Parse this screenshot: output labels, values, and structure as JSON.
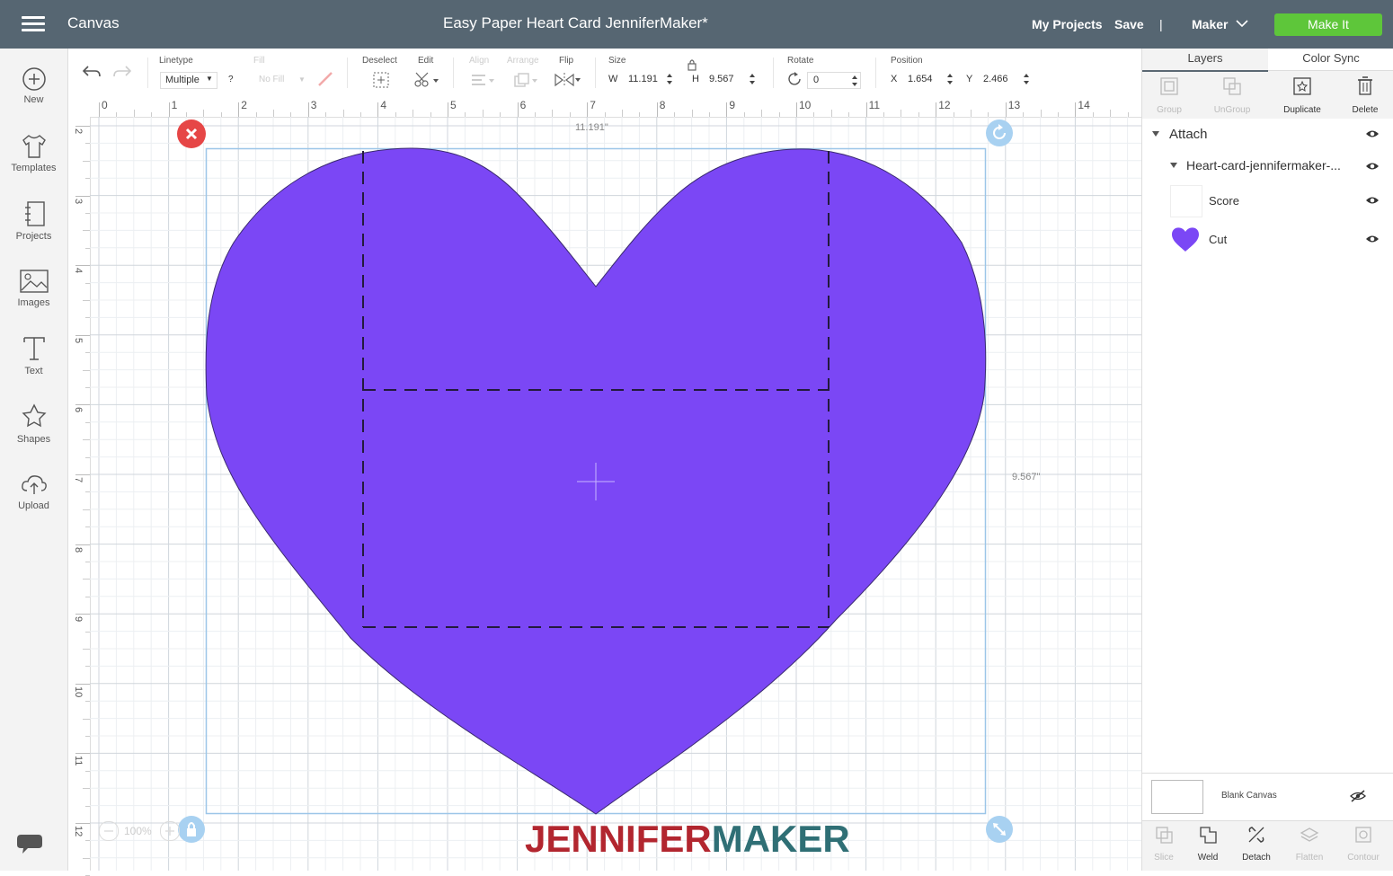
{
  "header": {
    "app_name": "Canvas",
    "project_title": "Easy Paper Heart Card JenniferMaker*",
    "my_projects": "My Projects",
    "save": "Save",
    "divider": "|",
    "machine": "Maker",
    "make_it": "Make It"
  },
  "sidebar": {
    "items": [
      {
        "label": "New",
        "icon": "plus-circle-icon"
      },
      {
        "label": "Templates",
        "icon": "shirt-icon"
      },
      {
        "label": "Projects",
        "icon": "projects-icon"
      },
      {
        "label": "Images",
        "icon": "image-icon"
      },
      {
        "label": "Text",
        "icon": "text-icon"
      },
      {
        "label": "Shapes",
        "icon": "shapes-icon"
      },
      {
        "label": "Upload",
        "icon": "upload-icon"
      }
    ]
  },
  "toolbar": {
    "linetype_label": "Linetype",
    "linetype_value": "Multiple",
    "linetype_help": "?",
    "fill_label": "Fill",
    "fill_value": "No Fill",
    "deselect_label": "Deselect",
    "edit_label": "Edit",
    "align_label": "Align",
    "arrange_label": "Arrange",
    "flip_label": "Flip",
    "size_label": "Size",
    "w_label": "W",
    "w_value": "11.191",
    "h_label": "H",
    "h_value": "9.567",
    "rotate_label": "Rotate",
    "rotate_value": "0",
    "position_label": "Position",
    "x_label": "X",
    "x_value": "1.654",
    "y_label": "Y",
    "y_value": "2.466"
  },
  "rulers": {
    "horizontal": [
      "0",
      "1",
      "2",
      "3",
      "4",
      "5",
      "6",
      "7",
      "8",
      "9",
      "10",
      "11",
      "12",
      "13",
      "14"
    ],
    "vertical": [
      "2",
      "3",
      "4",
      "5",
      "6",
      "7",
      "8",
      "9",
      "10",
      "11",
      "12"
    ]
  },
  "canvas": {
    "width_readout": "11.191\"",
    "height_readout": "9.567\"",
    "zoom": "100%",
    "heart_color": "#7b47f5",
    "watermark_part1": "JENNIFER",
    "watermark_part2": "MAKER"
  },
  "panel": {
    "tabs": [
      "Layers",
      "Color Sync"
    ],
    "actions": [
      {
        "label": "Group",
        "enabled": false
      },
      {
        "label": "UnGroup",
        "enabled": false
      },
      {
        "label": "Duplicate",
        "enabled": true
      },
      {
        "label": "Delete",
        "enabled": true
      }
    ],
    "layers": {
      "group_name": "Attach",
      "subgroup_name": "Heart-card-jennifermaker-...",
      "items": [
        "Score",
        "Cut"
      ]
    },
    "blank_canvas": "Blank Canvas",
    "bottom_actions": [
      {
        "label": "Slice",
        "enabled": false
      },
      {
        "label": "Weld",
        "enabled": true
      },
      {
        "label": "Detach",
        "enabled": true
      },
      {
        "label": "Flatten",
        "enabled": false
      },
      {
        "label": "Contour",
        "enabled": false
      }
    ]
  }
}
